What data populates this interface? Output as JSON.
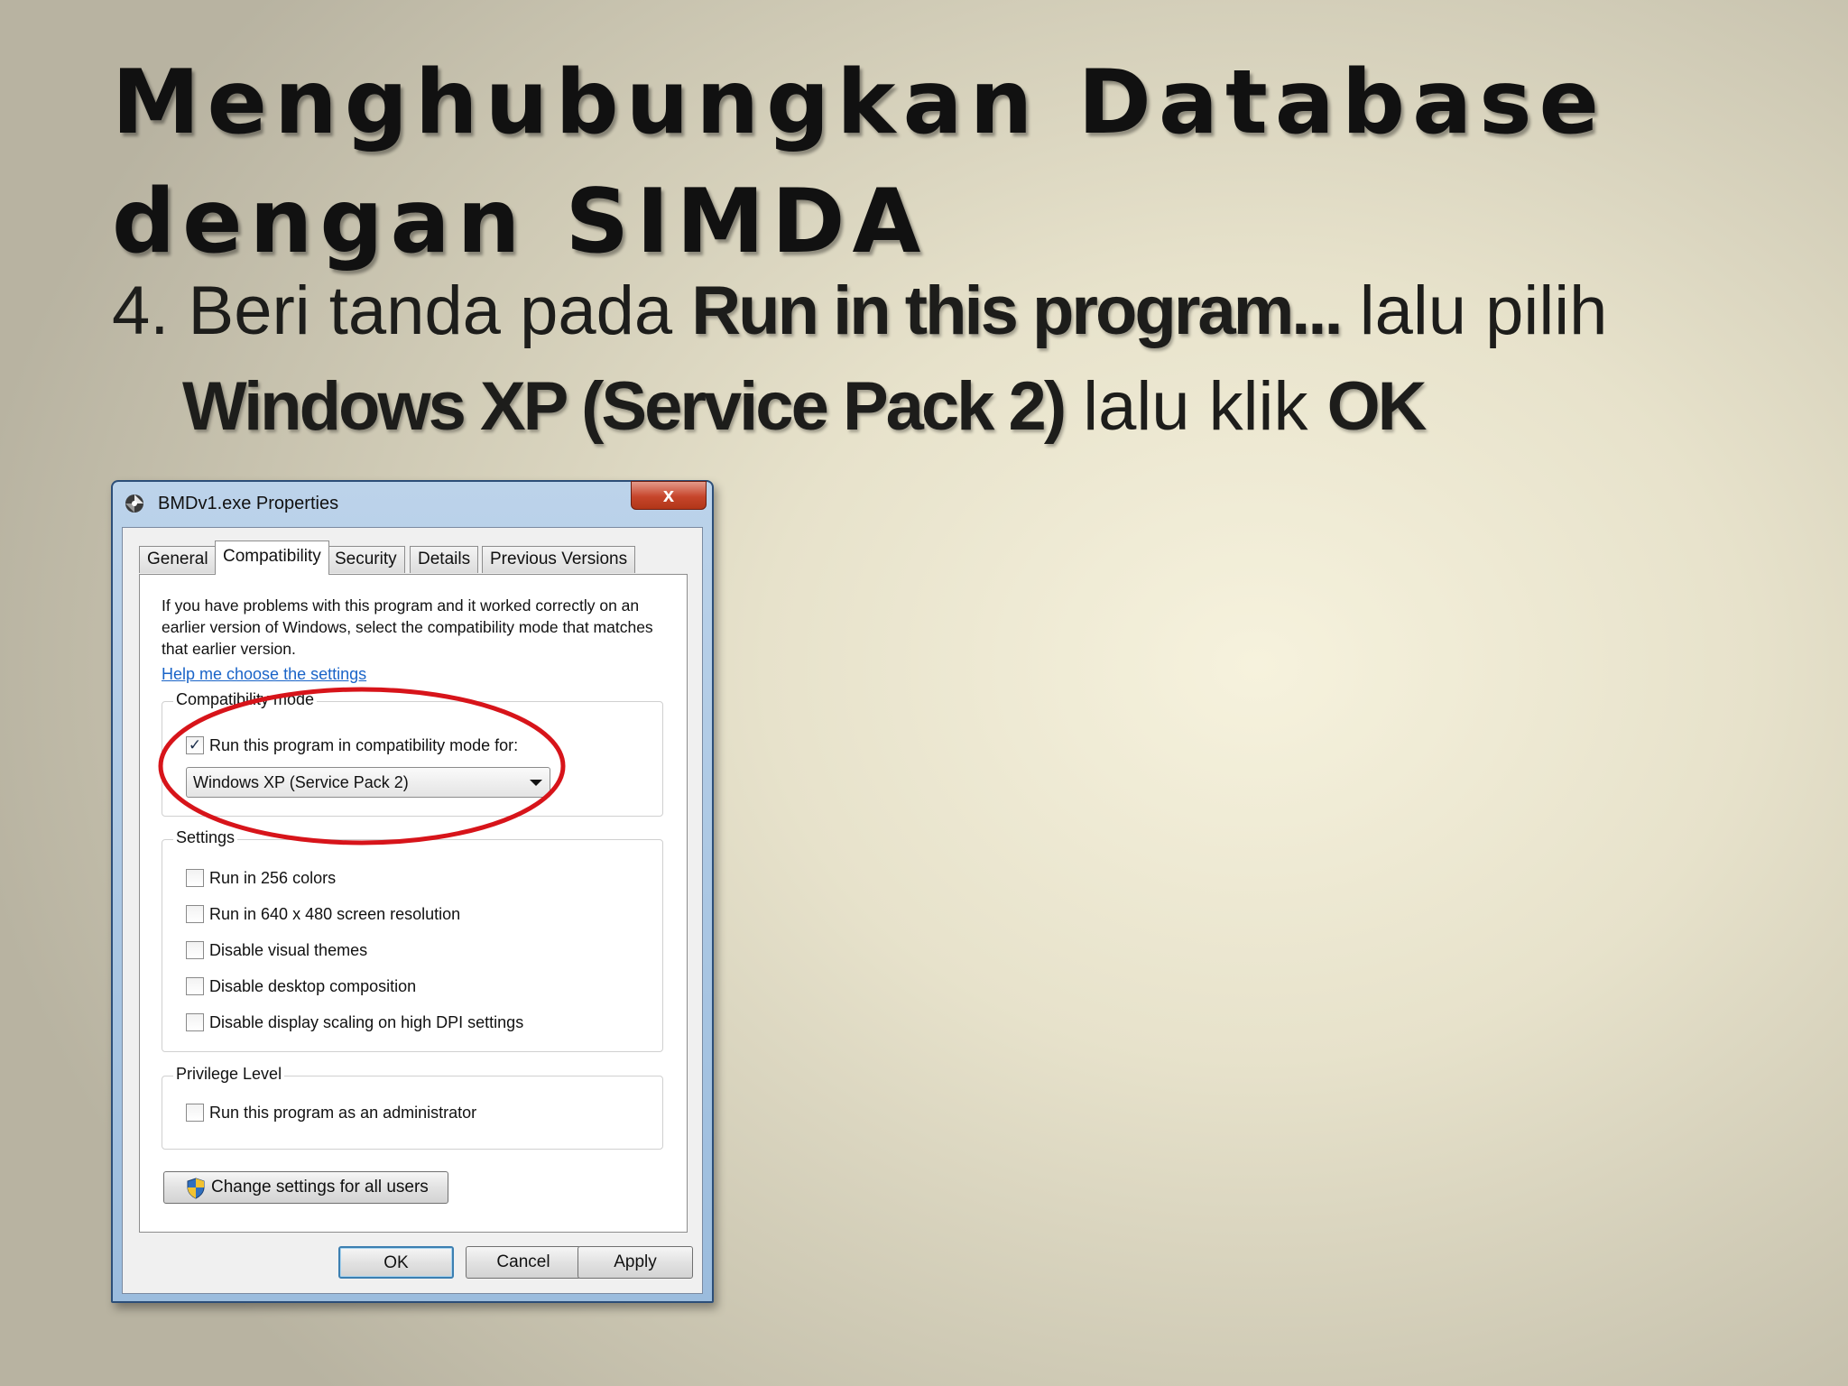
{
  "slide": {
    "title_line1": "Menghubungkan Database",
    "title_line2": "dengan SIMDA",
    "instruction": {
      "part1": "4. Beri tanda pada ",
      "bold1": "Run in this program...",
      "part2": " lalu pilih",
      "bold2": "Windows XP (Service Pack 2)",
      "part3": " lalu klik ",
      "bold3": "OK"
    }
  },
  "dialog": {
    "title": "BMDv1.exe Properties",
    "close_label": "x",
    "tabs": [
      "General",
      "Compatibility",
      "Security",
      "Details",
      "Previous Versions"
    ],
    "active_tab": "Compatibility",
    "description": "If you have problems with this program and it worked correctly on an earlier version of Windows, select the compatibility mode that matches that earlier version.",
    "help_link": "Help me choose the settings",
    "compatibility_mode": {
      "label": "Compatibility mode",
      "checkbox_label": "Run this program in compatibility mode for:",
      "checked": true,
      "selected_os": "Windows XP (Service Pack 2)"
    },
    "settings": {
      "label": "Settings",
      "options": [
        {
          "label": "Run in 256 colors",
          "checked": false
        },
        {
          "label": "Run in 640 x 480 screen resolution",
          "checked": false
        },
        {
          "label": "Disable visual themes",
          "checked": false
        },
        {
          "label": "Disable desktop composition",
          "checked": false
        },
        {
          "label": "Disable display scaling on high DPI settings",
          "checked": false
        }
      ]
    },
    "privilege": {
      "label": "Privilege Level",
      "checkbox_label": "Run this program as an administrator",
      "checked": false
    },
    "change_settings_button": "Change settings for all users",
    "buttons": {
      "ok": "OK",
      "cancel": "Cancel",
      "apply": "Apply"
    },
    "highlight_color": "#d7141a"
  }
}
